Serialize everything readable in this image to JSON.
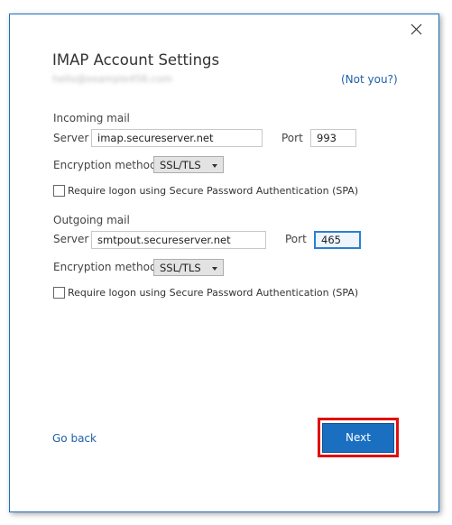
{
  "dialog": {
    "title": "IMAP Account Settings",
    "email": "hello@example456.com",
    "not_you": "(Not you?)",
    "close_icon": "close-icon",
    "incoming": {
      "heading": "Incoming mail",
      "server_label": "Server",
      "server_value": "imap.secureserver.net",
      "port_label": "Port",
      "port_value": "993",
      "encryption_label": "Encryption method",
      "encryption_value": "SSL/TLS",
      "spa_label": "Require logon using Secure Password Authentication (SPA)",
      "spa_checked": false
    },
    "outgoing": {
      "heading": "Outgoing mail",
      "server_label": "Server",
      "server_value": "smtpout.secureserver.net",
      "port_label": "Port",
      "port_value": "465",
      "encryption_label": "Encryption method",
      "encryption_value": "SSL/TLS",
      "spa_label": "Require logon using Secure Password Authentication (SPA)",
      "spa_checked": false
    },
    "go_back": "Go back",
    "next": "Next",
    "colors": {
      "accent": "#1a6fc0",
      "link": "#1e5fa8",
      "highlight": "#e01010"
    }
  }
}
